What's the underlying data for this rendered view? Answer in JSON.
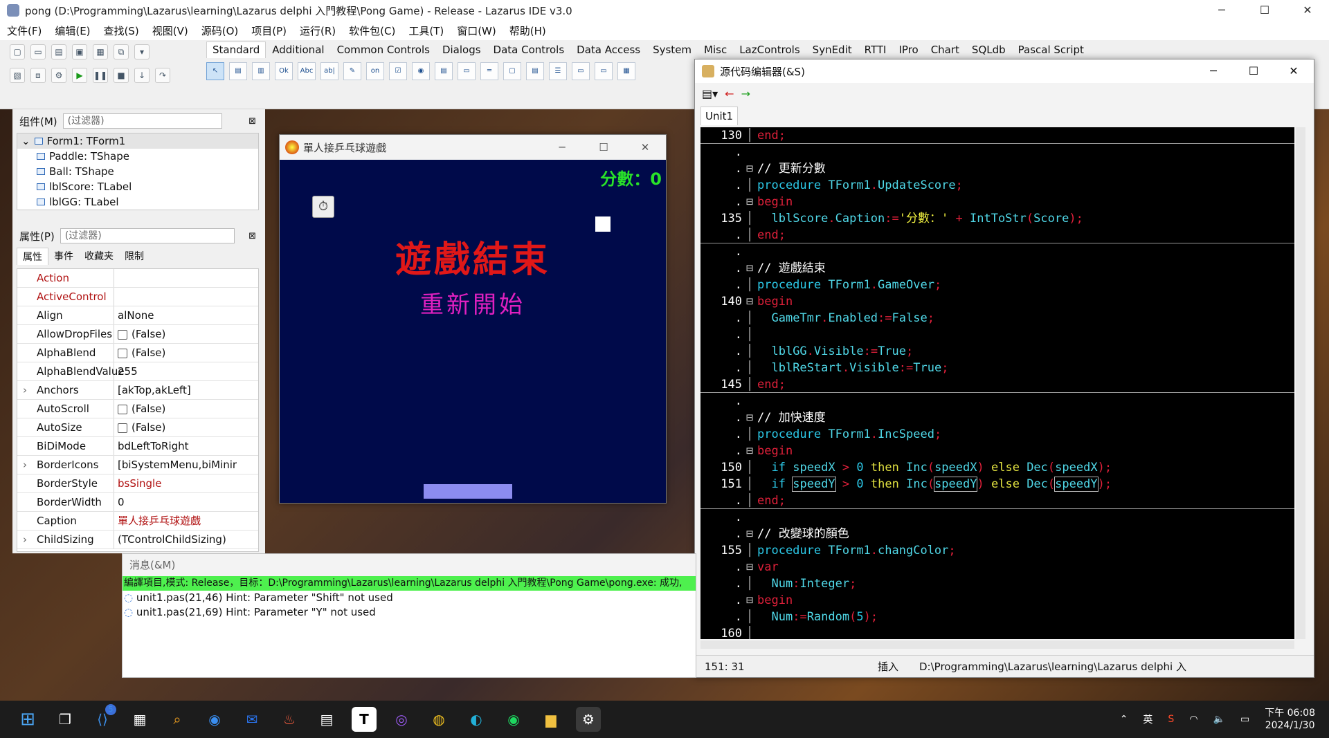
{
  "ide": {
    "title": "pong (D:\\Programming\\Lazarus\\learning\\Lazarus delphi 入門教程\\Pong Game) - Release - Lazarus IDE v3.0",
    "menu": [
      "文件(F)",
      "编辑(E)",
      "查找(S)",
      "视图(V)",
      "源码(O)",
      "项目(P)",
      "运行(R)",
      "软件包(C)",
      "工具(T)",
      "窗口(W)",
      "帮助(H)"
    ],
    "palette_tabs": [
      "Standard",
      "Additional",
      "Common Controls",
      "Dialogs",
      "Data Controls",
      "Data Access",
      "System",
      "Misc",
      "LazControls",
      "SynEdit",
      "RTTI",
      "IPro",
      "Chart",
      "SQLdb",
      "Pascal Script"
    ],
    "palette_icons": [
      "pointer",
      "TMainMenu",
      "TPopupMenu",
      "TButton",
      "TLabel",
      "TEdit",
      "TMemo",
      "TToggleBox",
      "TCheckBox",
      "TRadioButton",
      "TListBox",
      "TComboBox",
      "TScrollBar",
      "TGroupBox",
      "TRadioGroup",
      "TCheckGroup",
      "TPanel",
      "TFrame",
      "TActionList"
    ]
  },
  "components": {
    "header": "组件(M)",
    "filter_placeholder": "(过滤器)",
    "tree": [
      "Form1: TForm1",
      "Paddle: TShape",
      "Ball: TShape",
      "lblScore: TLabel",
      "lblGG: TLabel"
    ]
  },
  "properties": {
    "header": "属性(P)",
    "filter_placeholder": "(过滤器)",
    "tabs": [
      "属性",
      "事件",
      "收藏夹",
      "限制"
    ],
    "rows": [
      {
        "name": "Action",
        "value": "",
        "red": true
      },
      {
        "name": "ActiveControl",
        "value": "",
        "red": true
      },
      {
        "name": "Align",
        "value": "alNone"
      },
      {
        "name": "AllowDropFiles",
        "value": "(False)",
        "check": true
      },
      {
        "name": "AlphaBlend",
        "value": "(False)",
        "check": true
      },
      {
        "name": "AlphaBlendValue",
        "value": "255"
      },
      {
        "name": "Anchors",
        "value": "[akTop,akLeft]",
        "expand": true
      },
      {
        "name": "AutoScroll",
        "value": "(False)",
        "check": true
      },
      {
        "name": "AutoSize",
        "value": "(False)",
        "check": true
      },
      {
        "name": "BiDiMode",
        "value": "bdLeftToRight"
      },
      {
        "name": "BorderIcons",
        "value": "[biSystemMenu,biMinir",
        "expand": true
      },
      {
        "name": "BorderStyle",
        "value": "bsSingle",
        "valred": true
      },
      {
        "name": "BorderWidth",
        "value": "0"
      },
      {
        "name": "Caption",
        "value": "單人接乒乓球遊戲",
        "valred": true
      },
      {
        "name": "ChildSizing",
        "value": "(TControlChildSizing)",
        "expand": true
      }
    ]
  },
  "game": {
    "title": "單人接乒乓球遊戲",
    "score": "分數：0",
    "game_over": "遊戲結束",
    "restart": "重新開始",
    "timer_caption": "GameTmr"
  },
  "editor": {
    "title": "源代码编辑器(&S)",
    "tab": "Unit1",
    "status_pos": "151: 31",
    "status_mode": "插入",
    "status_path": "D:\\Programming\\Lazarus\\learning\\Lazarus delphi 入"
  },
  "messages": {
    "header": "消息(&M)",
    "success": "編譯項目,模式: Release，目标：D:\\Programming\\Lazarus\\learning\\Lazarus delphi 入門教程\\Pong Game\\pong.exe: 成功,",
    "hints": [
      "unit1.pas(21,46) Hint: Parameter \"Shift\" not used",
      "unit1.pas(21,69) Hint: Parameter \"Y\" not used"
    ]
  },
  "taskbar": {
    "lang": "英",
    "time": "下午 06:08",
    "date": "2024/1/30",
    "badge": "5"
  }
}
